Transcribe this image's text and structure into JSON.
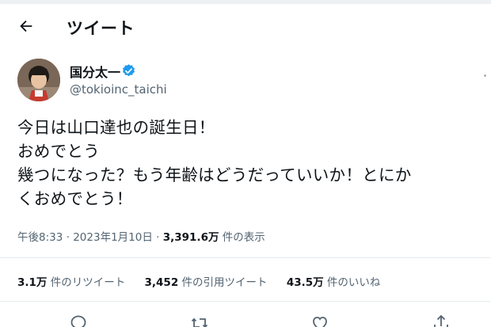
{
  "header": {
    "title": "ツイート"
  },
  "user": {
    "name": "国分太一",
    "handle": "@tokioinc_taichi"
  },
  "tweet": {
    "lines": [
      "今日は山口達也の誕生日！",
      "おめでとう",
      "幾つになった？もう年齢はどうだっていいか！とにか",
      "くおめでとう！"
    ]
  },
  "meta": {
    "time": "午後8:33",
    "sep": "·",
    "date": "2023年1月10日",
    "views": "3,391.6万",
    "views_label": "件の表示"
  },
  "stats": {
    "retweets": "3.1万",
    "retweets_label": "件のリツイート",
    "quotes": "3,452",
    "quotes_label": "件の引用ツイート",
    "likes": "43.5万",
    "likes_label": "件のいいね"
  },
  "icons": {
    "back": "arrow-left-icon",
    "verified": "verified-badge-icon",
    "more": "more-icon",
    "reply": "reply-icon",
    "retweet": "retweet-icon",
    "like": "heart-icon",
    "share": "share-icon"
  },
  "colors": {
    "verified": "#1d9bf0",
    "secondary_text": "#536471"
  }
}
